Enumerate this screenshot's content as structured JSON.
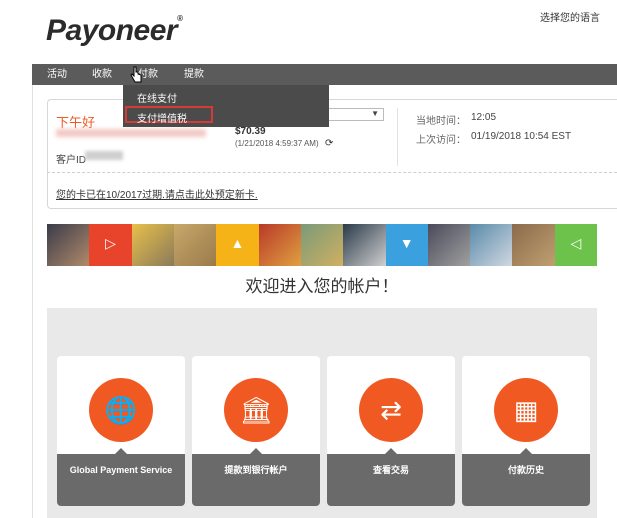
{
  "header": {
    "logo_text": "Payoneer",
    "language_link": "选择您的语言"
  },
  "nav": {
    "items": [
      "活动",
      "收款",
      "付款",
      "提款"
    ]
  },
  "dropdown": {
    "items": [
      "在线支付",
      "支付增值税"
    ]
  },
  "account": {
    "greeting": "下午好",
    "customer_id_label": "客户ID",
    "balance": "$70.39",
    "balance_timestamp": "(1/21/2018 4:59:37 AM)",
    "local_time_label": "当地时间：",
    "local_time": "12:05",
    "last_visit_label": "上次访问：",
    "last_visit": "01/19/2018 10:54 EST",
    "card_notice": "您的卡已在10/2017过期.请点击此处预定新卡."
  },
  "welcome": {
    "text": "欢迎进入您的帐户！"
  },
  "cards": [
    {
      "label": "Global Payment Service",
      "icon": "hand-globe-icon"
    },
    {
      "label": "提款到银行帐户",
      "icon": "bank-icon"
    },
    {
      "label": "查看交易",
      "icon": "exchange-arrows-icon"
    },
    {
      "label": "付款历史",
      "icon": "calendar-icon"
    }
  ],
  "colors": {
    "accent": "#f05a22",
    "nav_bg": "#5b5b5b",
    "highlight_border": "#d63a36",
    "banner_red": "#e8442c",
    "banner_yellow": "#f6b318",
    "banner_blue": "#3aa0de",
    "banner_green": "#6cc24a"
  }
}
